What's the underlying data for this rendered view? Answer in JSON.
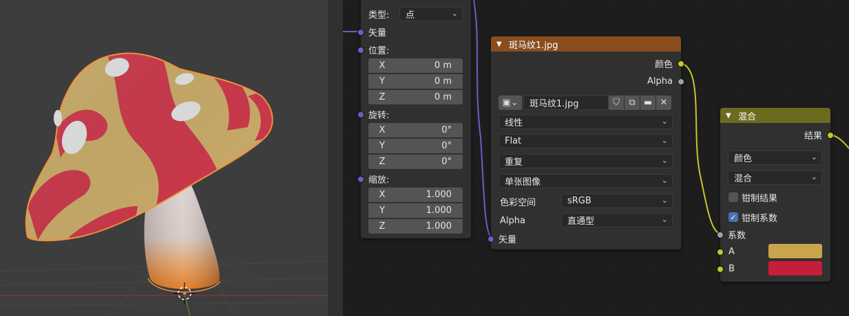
{
  "colors": {
    "viewport_bg": "#3d3d3d",
    "editor_bg": "#1d1d1d",
    "node_bg": "#303030",
    "texture_header": "#8a4d1d",
    "mix_header": "#6b6b1f",
    "socket_vector": "#6363c7",
    "socket_color": "#c7c729",
    "socket_float": "#a1a1a1",
    "swatch_a": "#c9a64d",
    "swatch_b": "#c41e3a",
    "selection_outline": "#f0903c",
    "checkbox_on": "#4772b3"
  },
  "mapping_node": {
    "type_label": "类型:",
    "type_value": "点",
    "vector_in": "矢量",
    "location_label": "位置:",
    "location": [
      {
        "axis": "X",
        "value": "0 m"
      },
      {
        "axis": "Y",
        "value": "0 m"
      },
      {
        "axis": "Z",
        "value": "0 m"
      }
    ],
    "rotation_label": "旋转:",
    "rotation": [
      {
        "axis": "X",
        "value": "0°"
      },
      {
        "axis": "Y",
        "value": "0°"
      },
      {
        "axis": "Z",
        "value": "0°"
      }
    ],
    "scale_label": "缩放:",
    "scale": [
      {
        "axis": "X",
        "value": "1.000"
      },
      {
        "axis": "Y",
        "value": "1.000"
      },
      {
        "axis": "Z",
        "value": "1.000"
      }
    ]
  },
  "texture_node": {
    "title": "斑马纹1.jpg",
    "out_color": "颜色",
    "out_alpha": "Alpha",
    "image_name": "斑马纹1.jpg",
    "interpolation": "线性",
    "projection": "Flat",
    "extension": "重复",
    "source": "单张图像",
    "colorspace_label": "色彩空间",
    "colorspace_value": "sRGB",
    "alpha_label": "Alpha",
    "alpha_value": "直通型",
    "vector_in": "矢量",
    "icons": [
      "image-type-icon",
      "fake-user-shield-icon",
      "duplicate-icon",
      "open-folder-icon",
      "unlink-icon"
    ]
  },
  "mix_node": {
    "title": "混合",
    "out_result": "结果",
    "data_type": "颜色",
    "blend_mode": "混合",
    "clamp_result_label": "钳制结果",
    "clamp_result_checked": false,
    "clamp_factor_label": "钳制系数",
    "clamp_factor_checked": true,
    "factor_label": "系数",
    "a_label": "A",
    "b_label": "B"
  }
}
